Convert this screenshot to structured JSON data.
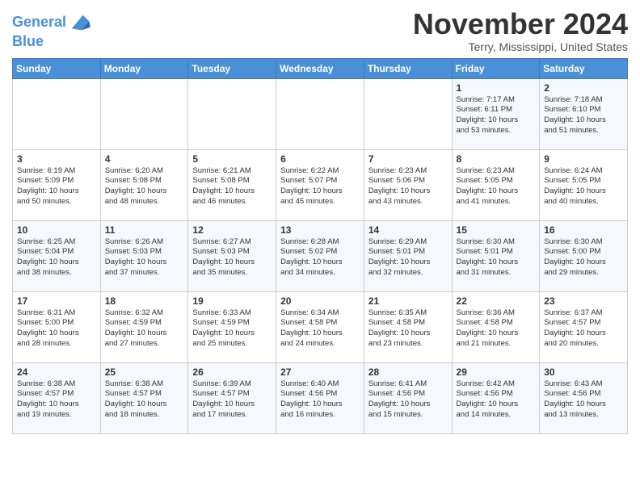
{
  "header": {
    "logo_line1": "General",
    "logo_line2": "Blue",
    "month": "November 2024",
    "location": "Terry, Mississippi, United States"
  },
  "days_of_week": [
    "Sunday",
    "Monday",
    "Tuesday",
    "Wednesday",
    "Thursday",
    "Friday",
    "Saturday"
  ],
  "weeks": [
    [
      {
        "day": "",
        "info": ""
      },
      {
        "day": "",
        "info": ""
      },
      {
        "day": "",
        "info": ""
      },
      {
        "day": "",
        "info": ""
      },
      {
        "day": "",
        "info": ""
      },
      {
        "day": "1",
        "info": "Sunrise: 7:17 AM\nSunset: 6:11 PM\nDaylight: 10 hours\nand 53 minutes."
      },
      {
        "day": "2",
        "info": "Sunrise: 7:18 AM\nSunset: 6:10 PM\nDaylight: 10 hours\nand 51 minutes."
      }
    ],
    [
      {
        "day": "3",
        "info": "Sunrise: 6:19 AM\nSunset: 5:09 PM\nDaylight: 10 hours\nand 50 minutes."
      },
      {
        "day": "4",
        "info": "Sunrise: 6:20 AM\nSunset: 5:08 PM\nDaylight: 10 hours\nand 48 minutes."
      },
      {
        "day": "5",
        "info": "Sunrise: 6:21 AM\nSunset: 5:08 PM\nDaylight: 10 hours\nand 46 minutes."
      },
      {
        "day": "6",
        "info": "Sunrise: 6:22 AM\nSunset: 5:07 PM\nDaylight: 10 hours\nand 45 minutes."
      },
      {
        "day": "7",
        "info": "Sunrise: 6:23 AM\nSunset: 5:06 PM\nDaylight: 10 hours\nand 43 minutes."
      },
      {
        "day": "8",
        "info": "Sunrise: 6:23 AM\nSunset: 5:05 PM\nDaylight: 10 hours\nand 41 minutes."
      },
      {
        "day": "9",
        "info": "Sunrise: 6:24 AM\nSunset: 5:05 PM\nDaylight: 10 hours\nand 40 minutes."
      }
    ],
    [
      {
        "day": "10",
        "info": "Sunrise: 6:25 AM\nSunset: 5:04 PM\nDaylight: 10 hours\nand 38 minutes."
      },
      {
        "day": "11",
        "info": "Sunrise: 6:26 AM\nSunset: 5:03 PM\nDaylight: 10 hours\nand 37 minutes."
      },
      {
        "day": "12",
        "info": "Sunrise: 6:27 AM\nSunset: 5:03 PM\nDaylight: 10 hours\nand 35 minutes."
      },
      {
        "day": "13",
        "info": "Sunrise: 6:28 AM\nSunset: 5:02 PM\nDaylight: 10 hours\nand 34 minutes."
      },
      {
        "day": "14",
        "info": "Sunrise: 6:29 AM\nSunset: 5:01 PM\nDaylight: 10 hours\nand 32 minutes."
      },
      {
        "day": "15",
        "info": "Sunrise: 6:30 AM\nSunset: 5:01 PM\nDaylight: 10 hours\nand 31 minutes."
      },
      {
        "day": "16",
        "info": "Sunrise: 6:30 AM\nSunset: 5:00 PM\nDaylight: 10 hours\nand 29 minutes."
      }
    ],
    [
      {
        "day": "17",
        "info": "Sunrise: 6:31 AM\nSunset: 5:00 PM\nDaylight: 10 hours\nand 28 minutes."
      },
      {
        "day": "18",
        "info": "Sunrise: 6:32 AM\nSunset: 4:59 PM\nDaylight: 10 hours\nand 27 minutes."
      },
      {
        "day": "19",
        "info": "Sunrise: 6:33 AM\nSunset: 4:59 PM\nDaylight: 10 hours\nand 25 minutes."
      },
      {
        "day": "20",
        "info": "Sunrise: 6:34 AM\nSunset: 4:58 PM\nDaylight: 10 hours\nand 24 minutes."
      },
      {
        "day": "21",
        "info": "Sunrise: 6:35 AM\nSunset: 4:58 PM\nDaylight: 10 hours\nand 23 minutes."
      },
      {
        "day": "22",
        "info": "Sunrise: 6:36 AM\nSunset: 4:58 PM\nDaylight: 10 hours\nand 21 minutes."
      },
      {
        "day": "23",
        "info": "Sunrise: 6:37 AM\nSunset: 4:57 PM\nDaylight: 10 hours\nand 20 minutes."
      }
    ],
    [
      {
        "day": "24",
        "info": "Sunrise: 6:38 AM\nSunset: 4:57 PM\nDaylight: 10 hours\nand 19 minutes."
      },
      {
        "day": "25",
        "info": "Sunrise: 6:38 AM\nSunset: 4:57 PM\nDaylight: 10 hours\nand 18 minutes."
      },
      {
        "day": "26",
        "info": "Sunrise: 6:39 AM\nSunset: 4:57 PM\nDaylight: 10 hours\nand 17 minutes."
      },
      {
        "day": "27",
        "info": "Sunrise: 6:40 AM\nSunset: 4:56 PM\nDaylight: 10 hours\nand 16 minutes."
      },
      {
        "day": "28",
        "info": "Sunrise: 6:41 AM\nSunset: 4:56 PM\nDaylight: 10 hours\nand 15 minutes."
      },
      {
        "day": "29",
        "info": "Sunrise: 6:42 AM\nSunset: 4:56 PM\nDaylight: 10 hours\nand 14 minutes."
      },
      {
        "day": "30",
        "info": "Sunrise: 6:43 AM\nSunset: 4:56 PM\nDaylight: 10 hours\nand 13 minutes."
      }
    ]
  ]
}
